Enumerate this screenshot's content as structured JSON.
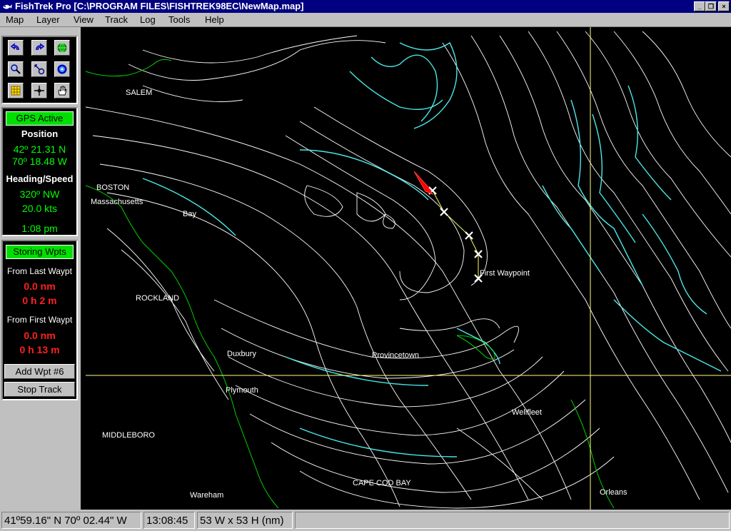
{
  "window": {
    "title": "FishTrek Pro [C:\\PROGRAM FILES\\FISHTREK98EC\\NewMap.map]"
  },
  "menu": [
    "Map",
    "Layer",
    "View",
    "Track",
    "Log",
    "Tools",
    "Help"
  ],
  "toolbar": {
    "icons": [
      "undo-icon",
      "redo-icon",
      "globe-icon",
      "zoom-icon",
      "measure-icon",
      "target-icon",
      "grid-icon",
      "crosshair-icon",
      "hand-icon"
    ]
  },
  "gps": {
    "status": "GPS Active",
    "position_label": "Position",
    "lat": "42º 21.31 N",
    "lon": "70º 18.48 W",
    "heading_speed_label": "Heading/Speed",
    "heading": "320º NW",
    "speed": "20.0 kts",
    "time": "1:08 pm"
  },
  "waypoints": {
    "status": "Storing Wpts",
    "from_last_label": "From Last Waypt",
    "from_last_dist": "0.0 nm",
    "from_last_time": "0 h 2 m",
    "from_first_label": "From First Waypt",
    "from_first_dist": "0.0 nm",
    "from_first_time": "0 h 13 m",
    "add_button": "Add Wpt #6",
    "stop_button": "Stop Track"
  },
  "map": {
    "labels": {
      "salem": "SALEM",
      "boston": "BOSTON",
      "massachusetts": "Massachusetts",
      "bay": "Bay",
      "rockland": "ROCKLAND",
      "duxbury": "Duxbury",
      "plymouth": "Plymouth",
      "middleboro": "MIDDLEBORO",
      "wareham": "Wareham",
      "provincetown": "Provincetown",
      "wellfleet": "Wellfleet",
      "cape_cod_bay": "CAPE COD BAY",
      "orleans": "Orleans",
      "first_waypoint": "First Waypoint"
    },
    "colors": {
      "background": "#000000",
      "contour": "#ffffff",
      "deep_contour": "#4ae8e8",
      "coastline": "#00d000",
      "boat": "#ff0000",
      "crosshair": "#ffff80"
    }
  },
  "statusbar": {
    "cursor_position": "41º59.16\" N 70º 02.44\" W",
    "clock": "13:08:45",
    "extent": "53 W x 53 H (nm)"
  }
}
